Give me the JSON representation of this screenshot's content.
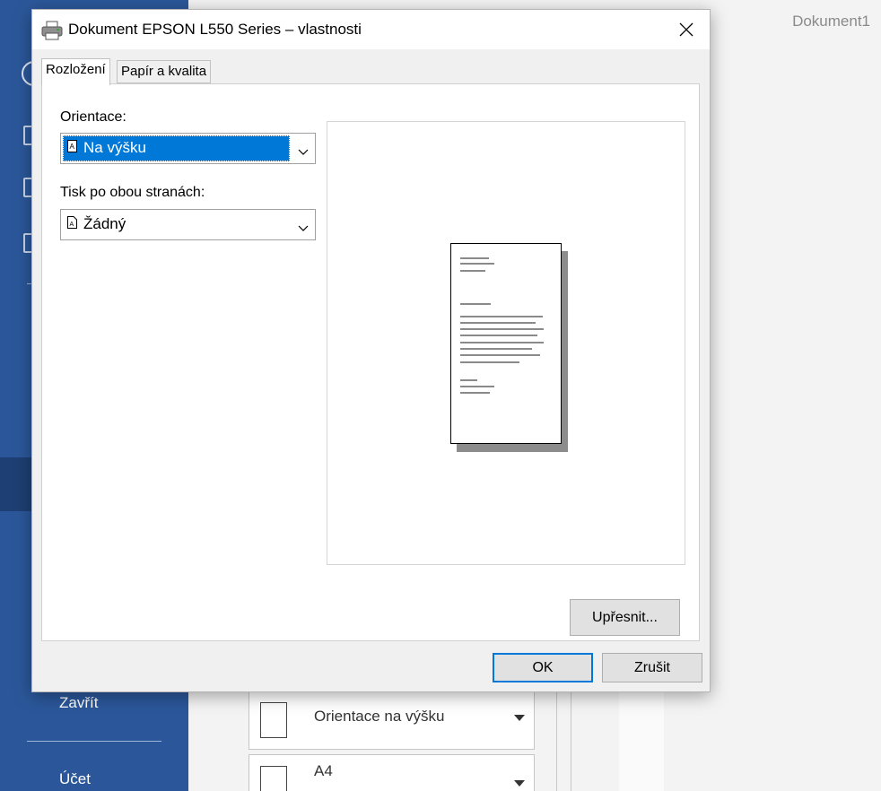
{
  "background": {
    "document_title": "Dokument1",
    "sidebar": {
      "close_label": "Zavřít",
      "account_label": "Účet"
    },
    "options": {
      "orientation_label": "Orientace na výšku",
      "paper_label": "A4"
    }
  },
  "dialog": {
    "title": "Dokument EPSON L550 Series – vlastnosti",
    "tabs": [
      {
        "label": "Rozložení",
        "active": true
      },
      {
        "label": "Papír a kvalita",
        "active": false
      }
    ],
    "orientation": {
      "label": "Orientace:",
      "value": "Na výšku"
    },
    "duplex": {
      "label": "Tisk po obou stranách:",
      "value": "Žádný"
    },
    "advanced_button": "Upřesnit...",
    "ok_button": "OK",
    "cancel_button": "Zrušit"
  },
  "colors": {
    "word_blue": "#2b579a",
    "selection_blue": "#0078d7"
  }
}
